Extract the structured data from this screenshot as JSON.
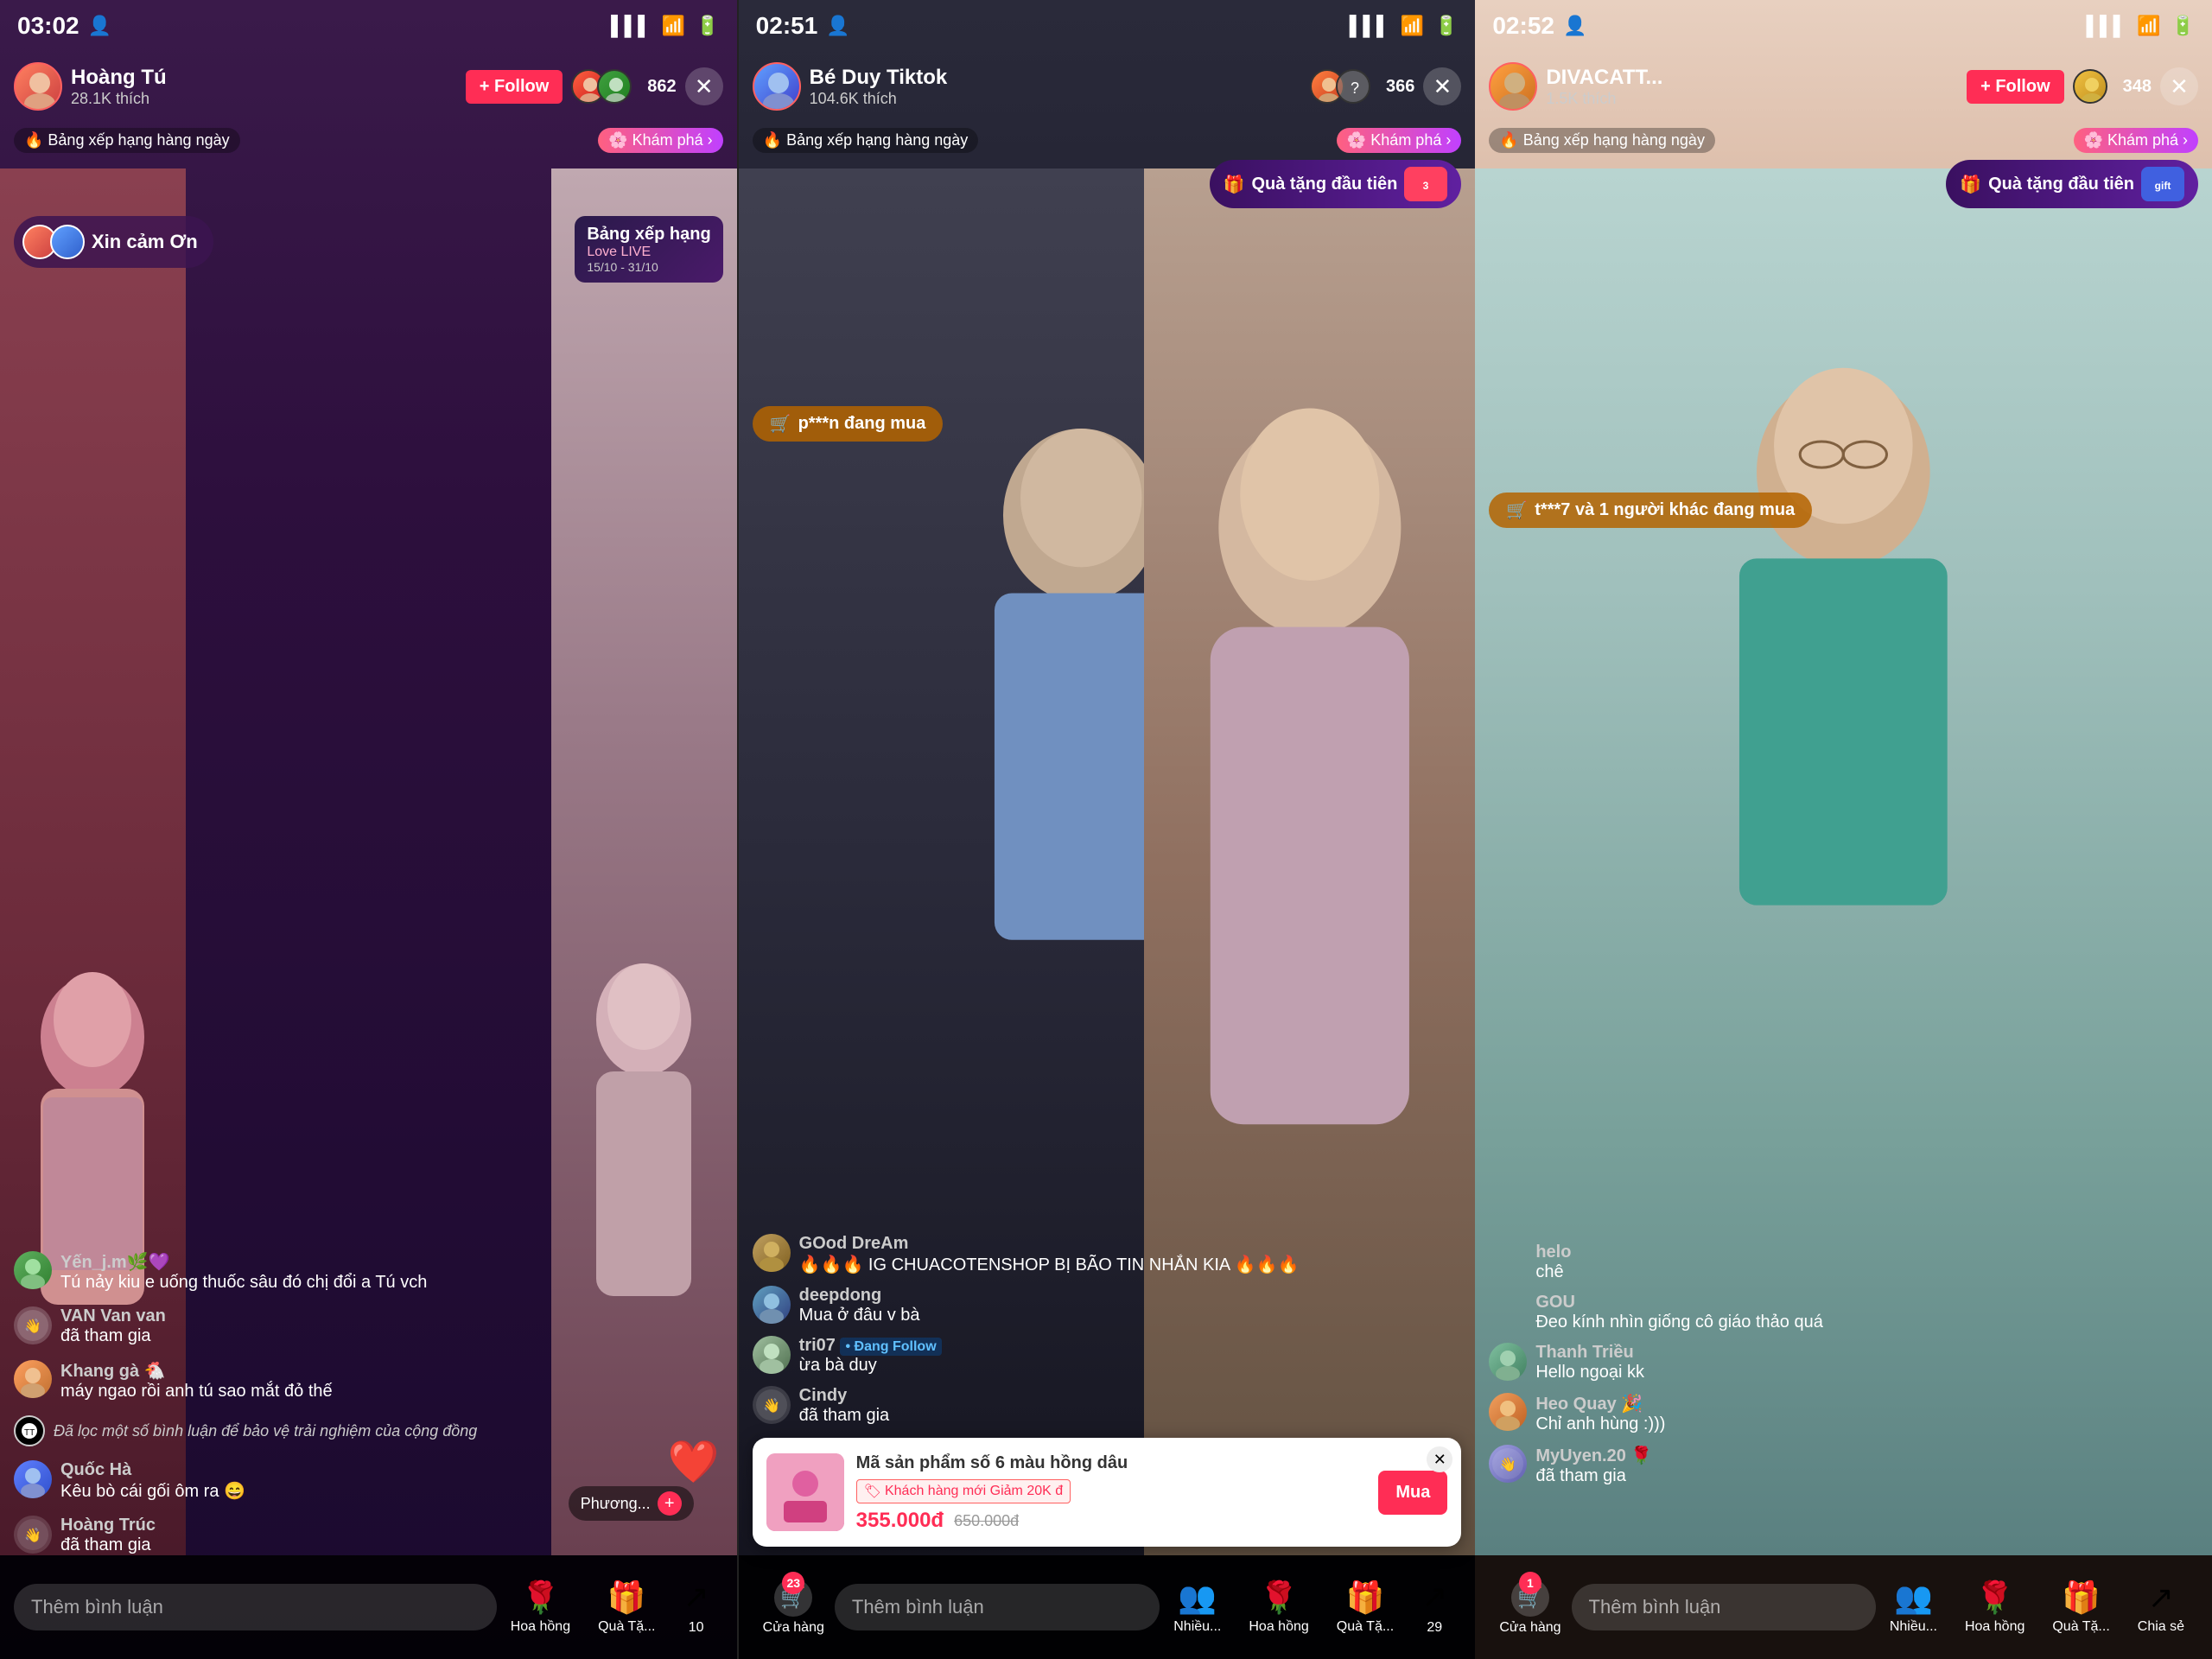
{
  "panels": [
    {
      "id": "panel1",
      "status_time": "03:02",
      "streamer_name": "Hoàng Tú",
      "streamer_likes": "28.1K thích",
      "follow_label": "+ Follow",
      "viewer_count": "862",
      "close_btn": "✕",
      "rank_label": "🔥 Bảng xếp hạng hàng ngày",
      "explore_label": "🌸 Khám phá ›",
      "xin_cam_on": "Xin cảm Ơn",
      "rank_card_title": "Bảng xếp hạng",
      "rank_card_sub": "Love LIVE",
      "rank_date": "15/10 - 31/10",
      "comments": [
        {
          "name": "Yến_j.m🌿💜",
          "text": "Tú nảy kiu e uống thuốc sâu đó chị đổi a Tú vch",
          "has_avatar": true
        },
        {
          "name": "VAN Van van",
          "text": "đã tham gia",
          "is_join": true
        },
        {
          "name": "Khang gà 🐔",
          "text": "máy ngao rồi anh tú sao mắt đỏ thế",
          "has_avatar": true
        },
        {
          "name": "",
          "text": "Đã lọc một số bình luận để bảo vệ trải nghiệm của cộng đồng",
          "is_system": true
        },
        {
          "name": "Quốc Hà",
          "text": "Kêu bò cái gối ôm ra 😄",
          "has_avatar": true
        },
        {
          "name": "Hoàng Trúc",
          "text": "đã tham gia",
          "is_join": true
        }
      ],
      "comment_placeholder": "Thêm bình luận",
      "toolbar": {
        "rose_label": "Hoa hồng",
        "gift_label": "Quà Tặ...",
        "share_count": "10"
      },
      "phuong_label": "Phương..."
    },
    {
      "id": "panel2",
      "status_time": "02:51",
      "streamer_name": "Bé Duy Tiktok",
      "streamer_likes": "104.6K thích",
      "viewer_count": "366",
      "close_btn": "✕",
      "rank_label": "🔥 Bảng xếp hạng hàng ngày",
      "explore_label": "🌸 Khám phá ›",
      "shopping_label": "p***n đang mua",
      "gift_banner": "Quà tặng đầu tiên",
      "igs_banner": "IG CHUACOTENSHOP BỊ BÃO TIN NHẮN",
      "comments": [
        {
          "name": "GOod DreAm",
          "text": "🔥🔥🔥 IG CHUACOTENSHOP BỊ BÃO TIN NHẮN KIA 🔥🔥🔥",
          "has_avatar": true
        },
        {
          "name": "deepdong",
          "text": "Mua ở đâu v bà",
          "has_avatar": true
        },
        {
          "name": "tri07",
          "text": "• Đang Follow ừa bà duy",
          "has_avatar": true
        },
        {
          "name": "Cindy",
          "text": "đã tham gia",
          "is_join": true
        }
      ],
      "product": {
        "name": "Mã sản phẩm số 6 màu hồng dâu",
        "badge": "Khách hàng mới  Giảm 20K đ",
        "price_new": "355.000đ",
        "price_old": "650.000đ",
        "buy_label": "Mua"
      },
      "comment_placeholder": "Thêm bình luận",
      "toolbar": {
        "cua_hang_label": "Cửa hàng",
        "cua_hang_num": "23",
        "rose_label": "Hoa hồng",
        "gift_label": "Quà Tặ...",
        "share_count": "29"
      }
    },
    {
      "id": "panel3",
      "status_time": "02:52",
      "streamer_name": "DIVACATT...",
      "streamer_likes": "1.5K thích",
      "follow_label": "+ Follow",
      "viewer_count": "348",
      "close_btn": "✕",
      "rank_label": "🔥 Bảng xếp hạng hàng ngày",
      "explore_label": "🌸 Khám phá ›",
      "shopping_label": "t***7 và 1 người khác đang mua",
      "gift_banner": "Quà tặng đầu tiên",
      "comments": [
        {
          "name": "helo",
          "text": "chê",
          "has_avatar": false
        },
        {
          "name": "GOU",
          "text": "Đeo kính nhìn giống cô giáo thảo quá",
          "has_avatar": false
        },
        {
          "name": "Thanh Triều",
          "text": "Hello ngoại kk",
          "has_avatar": true
        },
        {
          "name": "Heo Quay 🎉",
          "text": "Chỉ anh hùng :)))",
          "has_avatar": true
        },
        {
          "name": "MyUyen.20 🌹",
          "text": "đã tham gia",
          "is_join": true
        }
      ],
      "comment_placeholder": "Thêm bình luận",
      "toolbar": {
        "cua_hang_label": "Cửa hàng",
        "cua_hang_num": "1",
        "nhieu_label": "Nhiều...",
        "rose_label": "Hoa hồng",
        "gift_label": "Quà Tặ...",
        "share_label": "Chia sẻ"
      }
    }
  ]
}
